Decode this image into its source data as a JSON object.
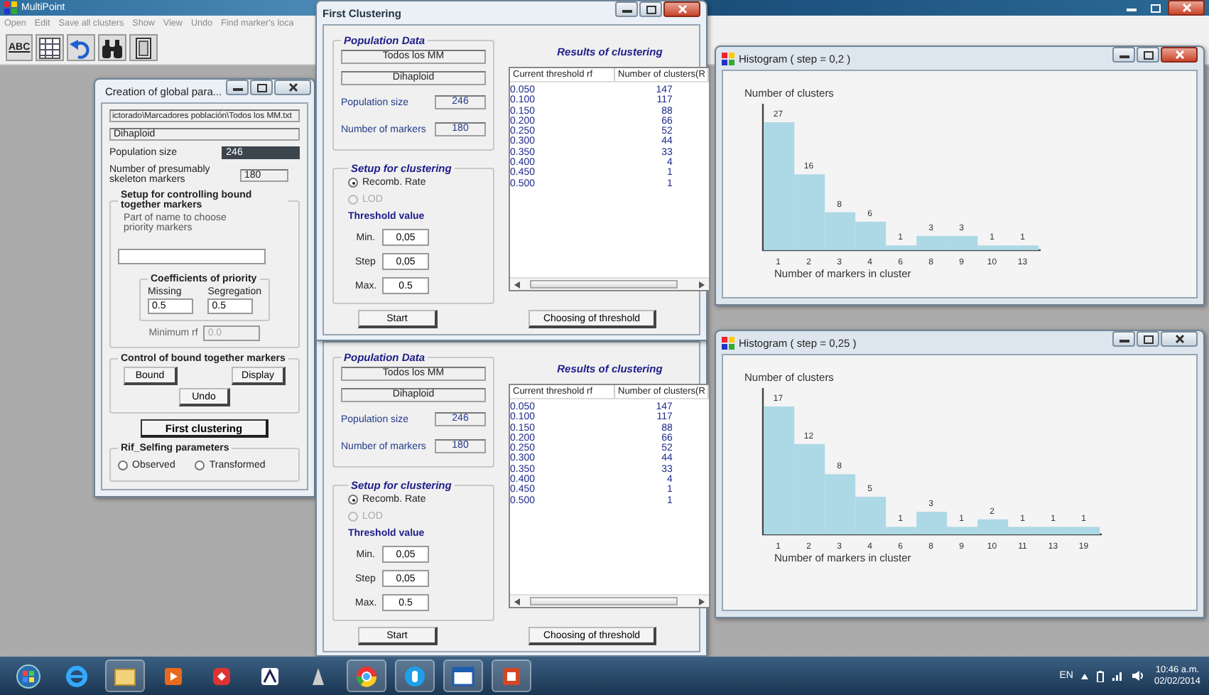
{
  "app": {
    "title": "MultiPoint",
    "menu": [
      "Open",
      "Edit",
      "Save all clusters",
      "Show",
      "View",
      "Undo",
      "Find marker's loca"
    ],
    "toolbar_text": "ABC"
  },
  "params_window": {
    "title": "Creation of global para...",
    "file_path": "ictorado\\Marcadores población\\Todos los MM.txt",
    "ploidy": "Dihaploid",
    "size_label": "Population size",
    "size": {
      "value": "246",
      "highlighted": true
    },
    "markers_label": "Number of presumably skeleton markers",
    "markers": {
      "value": "180",
      "highlighted": false
    },
    "bound_group": {
      "title": "Setup for controlling bound together markers",
      "hint": "Part of name to choose  priority markers",
      "coefficients": {
        "title": "Coefficients of priority",
        "fields": [
          {
            "label": "Missing",
            "value": "0.5"
          },
          {
            "label": "Segregation",
            "value": "0.5"
          }
        ]
      },
      "minimum": {
        "label": "Minimum rf",
        "value": "0.0",
        "disabled": true
      }
    },
    "control_group": {
      "title": "Control of bound together markers",
      "buttons": [
        "Bound",
        "Display",
        "Undo"
      ]
    },
    "main_button": "First clustering",
    "selfing_group": {
      "title": "Rif_Selfing parameters",
      "options": [
        {
          "label": "Observed",
          "selected": false
        },
        {
          "label": "Transformed",
          "selected": false
        }
      ]
    }
  },
  "clustering_windows": [
    {
      "title": "First Clustering",
      "active": true,
      "population": {
        "title": "Population Data",
        "name": "Todos los MM",
        "ploidy": "Dihaploid",
        "size_label": "Population size",
        "size": "246",
        "markers_label": "Number of markers",
        "markers": "180"
      },
      "setup": {
        "title": "Setup for clustering",
        "options": [
          {
            "label": "Recomb. Rate",
            "selected": true,
            "disabled": false
          },
          {
            "label": "LOD",
            "selected": false,
            "disabled": true
          }
        ],
        "threshold_label": "Threshold value",
        "fields": [
          {
            "label": "Min.",
            "value": "0,05"
          },
          {
            "label": "Step",
            "value": "0,05"
          },
          {
            "label": "Max.",
            "value": "0.5"
          }
        ]
      },
      "results": {
        "title": "Results of clustering",
        "columns": [
          "Current threshold rf",
          "Number of clusters(R"
        ],
        "rows": [
          [
            "0.050",
            "147"
          ],
          [
            "0.100",
            "117"
          ],
          [
            "0.150",
            "88"
          ],
          [
            "0.200",
            "66"
          ],
          [
            "0.250",
            "52"
          ],
          [
            "0.300",
            "44"
          ],
          [
            "0.350",
            "33"
          ],
          [
            "0.400",
            "4"
          ],
          [
            "0.450",
            "1"
          ],
          [
            "0.500",
            "1"
          ]
        ]
      },
      "buttons": [
        "Start",
        "Choosing of threshold"
      ]
    },
    {
      "population": {
        "title": "Population Data",
        "name": "Todos los MM",
        "ploidy": "Dihaploid",
        "size_label": "Population size",
        "size": "246",
        "markers_label": "Number of markers",
        "markers": "180"
      },
      "setup": {
        "title": "Setup for clustering",
        "options": [
          {
            "label": "Recomb. Rate",
            "selected": true,
            "disabled": false
          },
          {
            "label": "LOD",
            "selected": false,
            "disabled": true
          }
        ],
        "threshold_label": "Threshold value",
        "fields": [
          {
            "label": "Min.",
            "value": "0,05"
          },
          {
            "label": "Step",
            "value": "0,05"
          },
          {
            "label": "Max.",
            "value": "0.5"
          }
        ]
      },
      "results": {
        "title": "Results of clustering",
        "columns": [
          "Current threshold rf",
          "Number of clusters(R"
        ],
        "rows": [
          [
            "0.050",
            "147"
          ],
          [
            "0.100",
            "117"
          ],
          [
            "0.150",
            "88"
          ],
          [
            "0.200",
            "66"
          ],
          [
            "0.250",
            "52"
          ],
          [
            "0.300",
            "44"
          ],
          [
            "0.350",
            "33"
          ],
          [
            "0.400",
            "4"
          ],
          [
            "0.450",
            "1"
          ],
          [
            "0.500",
            "1"
          ]
        ]
      },
      "buttons": [
        "Start",
        "Choosing of threshold"
      ]
    }
  ],
  "histograms": [
    {
      "title": "Histogram ( step = 0,2 )",
      "active": true,
      "chart_data": {
        "type": "bar",
        "ylabel": "Number of clusters",
        "xlabel": "Number of markers in cluster",
        "categories": [
          "1",
          "2",
          "3",
          "4",
          "6",
          "8",
          "9",
          "10",
          "13"
        ],
        "values": [
          27,
          16,
          8,
          6,
          1,
          3,
          3,
          1,
          1
        ],
        "data_labels": true
      }
    },
    {
      "title": "Histogram ( step = 0,25 )",
      "active": false,
      "chart_data": {
        "type": "bar",
        "ylabel": "Number of clusters",
        "xlabel": "Number of markers in cluster",
        "categories": [
          "1",
          "2",
          "3",
          "4",
          "6",
          "8",
          "9",
          "10",
          "11",
          "13",
          "19"
        ],
        "values": [
          17,
          12,
          8,
          5,
          1,
          3,
          1,
          2,
          1,
          1,
          1
        ],
        "data_labels": true
      }
    }
  ],
  "taskbar": {
    "language": "EN",
    "time": "10:46 a.m.",
    "date": "02/02/2014"
  }
}
